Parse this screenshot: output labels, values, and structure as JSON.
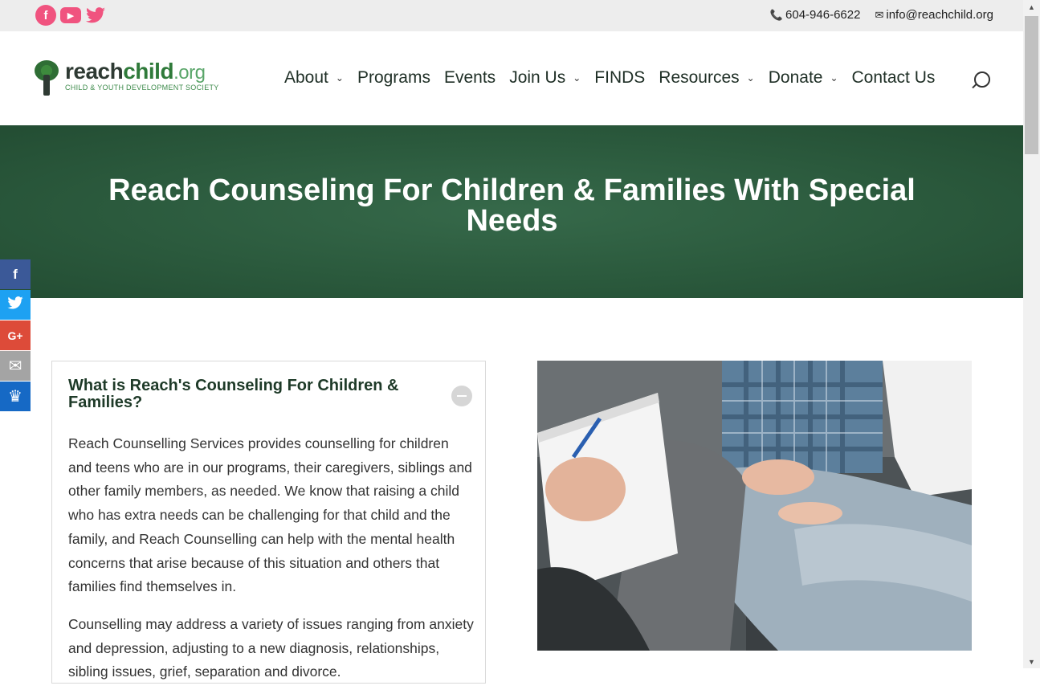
{
  "topbar": {
    "social": [
      {
        "name": "facebook",
        "glyph": "f"
      },
      {
        "name": "youtube",
        "glyph": "▶"
      },
      {
        "name": "twitter",
        "glyph": "🐦"
      }
    ],
    "phone": "604-946-6622",
    "email": "info@reachchild.org"
  },
  "logo": {
    "reach": "reach",
    "child": "child",
    "org": ".org",
    "tagline": "CHILD & YOUTH DEVELOPMENT SOCIETY"
  },
  "nav": {
    "items": [
      {
        "label": "About",
        "dropdown": true
      },
      {
        "label": "Programs",
        "dropdown": false
      },
      {
        "label": "Events",
        "dropdown": false
      },
      {
        "label": "Join Us",
        "dropdown": true
      },
      {
        "label": "FINDS",
        "dropdown": false
      },
      {
        "label": "Resources",
        "dropdown": true
      },
      {
        "label": "Donate",
        "dropdown": true
      },
      {
        "label": "Contact Us",
        "dropdown": false
      }
    ]
  },
  "hero": {
    "title": "Reach Counseling For Children & Families With Special Needs"
  },
  "share": [
    {
      "name": "facebook",
      "glyph": "f",
      "color": "#3b5998"
    },
    {
      "name": "twitter",
      "glyph": "t",
      "color": "#1da1f2"
    },
    {
      "name": "google-plus",
      "glyph": "G+",
      "color": "#dd4b39"
    },
    {
      "name": "email",
      "glyph": "✉",
      "color": "#a4a4a4"
    },
    {
      "name": "sumome",
      "glyph": "♛",
      "color": "#1669c5"
    }
  ],
  "accordion": {
    "title": "What is Reach's Counseling For Children & Families?",
    "paragraphs": [
      "Reach Counselling Services provides counselling for children and teens who are in our programs, their caregivers, siblings and other family members, as needed. We know that raising a child who has extra needs can be challenging for that child and the family, and Reach Counselling can help with the mental health concerns that arise because of this situation and others that families find themselves in.",
      "Counselling may address a variety of issues ranging from anxiety and depression, adjusting to a new diagnosis, relationships, sibling issues, grief, separation and divorce."
    ]
  },
  "colors": {
    "accent_pink": "#f0537f",
    "hero_green": "#2b5a3d",
    "nav_text": "#1f2f26"
  }
}
